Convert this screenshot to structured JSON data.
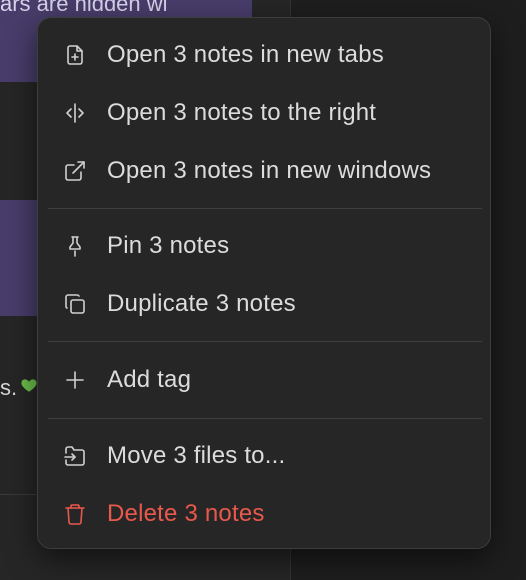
{
  "background": {
    "note_snippet_1": "ars are hidden wi",
    "note_snippet_2": "s.",
    "note_emoji_icon": "green-heart-icon"
  },
  "context_menu": {
    "items": [
      {
        "label": "Open 3 notes in new tabs",
        "icon": "file-plus-icon"
      },
      {
        "label": "Open 3 notes to the right",
        "icon": "split-view-icon"
      },
      {
        "label": "Open 3 notes in new windows",
        "icon": "external-link-icon"
      },
      {
        "label": "Pin 3 notes",
        "icon": "pin-icon"
      },
      {
        "label": "Duplicate 3 notes",
        "icon": "copy-icon"
      },
      {
        "label": "Add tag",
        "icon": "plus-icon"
      },
      {
        "label": "Move 3 files to...",
        "icon": "move-file-icon"
      },
      {
        "label": "Delete 3 notes",
        "icon": "trash-icon"
      }
    ]
  },
  "colors": {
    "menu_background": "#262626",
    "menu_text": "#dcdcdc",
    "danger": "#e8584c",
    "selected_note": "#483d6b"
  }
}
